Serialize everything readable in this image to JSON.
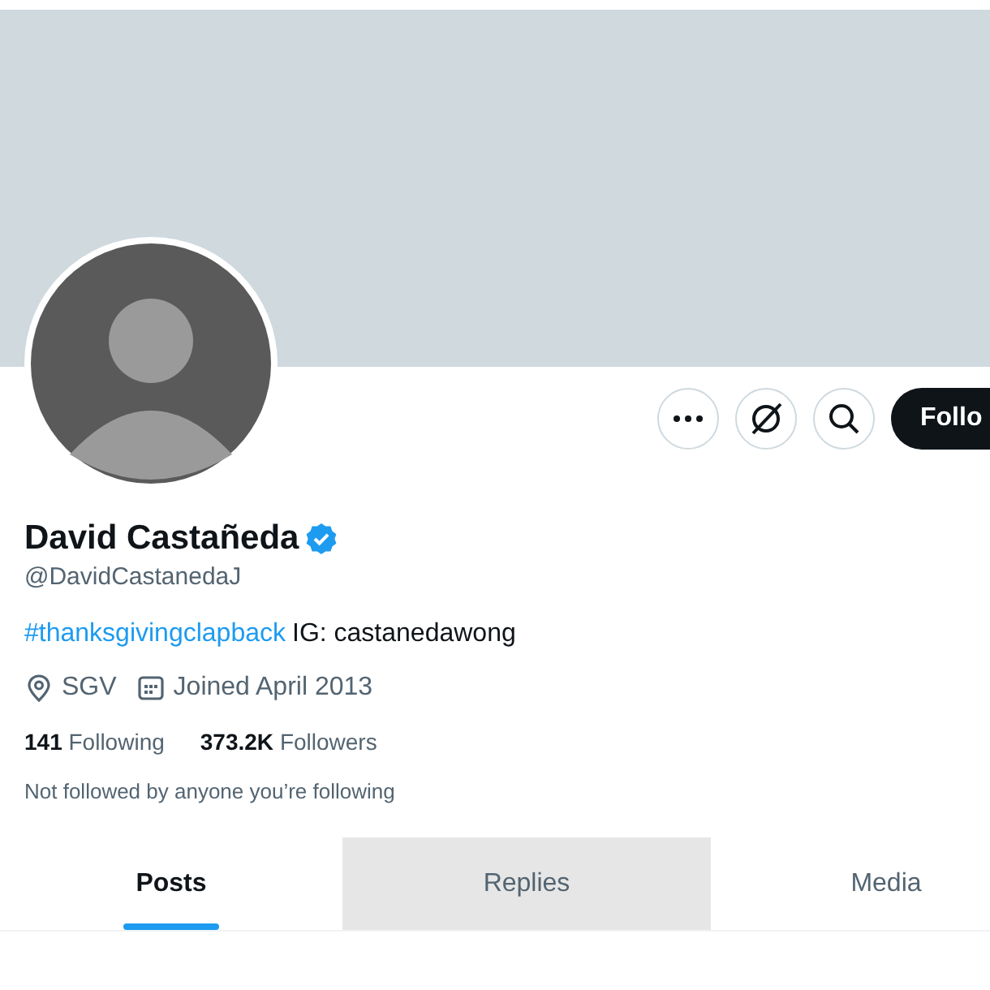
{
  "profile": {
    "name": "David Castañeda",
    "verified": true,
    "handle": "@DavidCastanedaJ",
    "bio": [
      {
        "kind": "hashtag",
        "text": "#thanksgivingclapback"
      },
      {
        "kind": "plain",
        "text": "IG: castanedawong"
      }
    ],
    "meta": [
      {
        "kind": "location",
        "text": "SGV"
      },
      {
        "kind": "joined",
        "text": "Joined April 2013"
      }
    ],
    "stats": [
      {
        "count": "141",
        "label": "Following"
      },
      {
        "count": "373.2K",
        "label": "Followers"
      }
    ],
    "followed_by": "Not followed by anyone you’re following"
  },
  "actions": [
    {
      "kind": "more"
    },
    {
      "kind": "grok"
    },
    {
      "kind": "search"
    },
    {
      "kind": "follow",
      "label": "Follo"
    }
  ],
  "tabs": [
    {
      "label": "Posts",
      "selected": true,
      "hovered": false
    },
    {
      "label": "Replies",
      "selected": false,
      "hovered": true
    },
    {
      "label": "Media",
      "selected": false,
      "hovered": false
    }
  ]
}
